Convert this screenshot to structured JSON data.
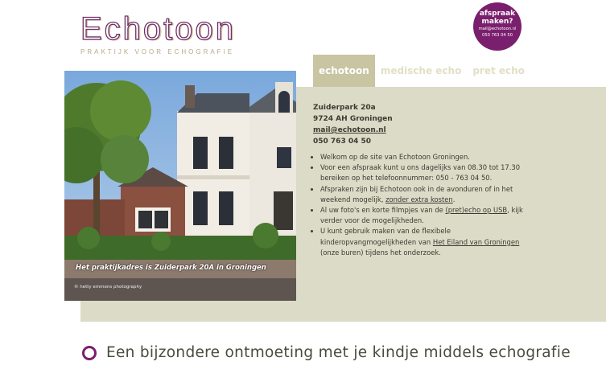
{
  "logo": {
    "title": "Echotoon",
    "subtitle": "PRAKTIJK VOOR ECHOGRAFIE"
  },
  "badge": {
    "line1": "afspraak",
    "line2": "maken?",
    "email": "mail@echotoon.nl",
    "phone": "050 763 04 50"
  },
  "tabs": [
    {
      "label": "echotoon",
      "active": true
    },
    {
      "label": "medische echo",
      "active": false
    },
    {
      "label": "pret echo",
      "active": false
    }
  ],
  "photo": {
    "caption": "Het praktijkadres is Zuiderpark 20A in Groningen",
    "credit": "© hetty emmens photography"
  },
  "address": {
    "street": "Zuiderpark 20a",
    "city": "9724 AH Groningen",
    "email": "mail@echotoon.nl",
    "phone": "050 763 04 50"
  },
  "content": {
    "item1": "Welkom op de site van Echotoon Groningen.",
    "item2": "Voor een afspraak kunt u ons dagelijks van 08.30 tot 17.30 bereiken op het telefoonnummer: 050 - 763 04 50.",
    "item3_pre": "Afspraken zijn bij Echotoon ook in de avonduren of in het weekend mogelijk, ",
    "item3_link": "zonder extra kosten",
    "item3_post": ".",
    "item4_pre": "Al uw foto's en korte filmpjes van de ",
    "item4_link": "(pret)echo op USB",
    "item4_post": ", kijk verder voor de mogelijkheden.",
    "item5_pre": "U kunt gebruik maken van de flexibele kinderopvangmogelijkheden van ",
    "item5_link": "Het Eiland van Groningen",
    "item5_post": " (onze buren) tijdens het onderzoek."
  },
  "tagline": "Een bijzondere ontmoeting met je kindje middels echografie",
  "colors": {
    "brand_purple": "#7a1f6e",
    "panel": "#dcdbc8",
    "tab_active": "#c9c4a1",
    "gold": "#b4a987"
  }
}
